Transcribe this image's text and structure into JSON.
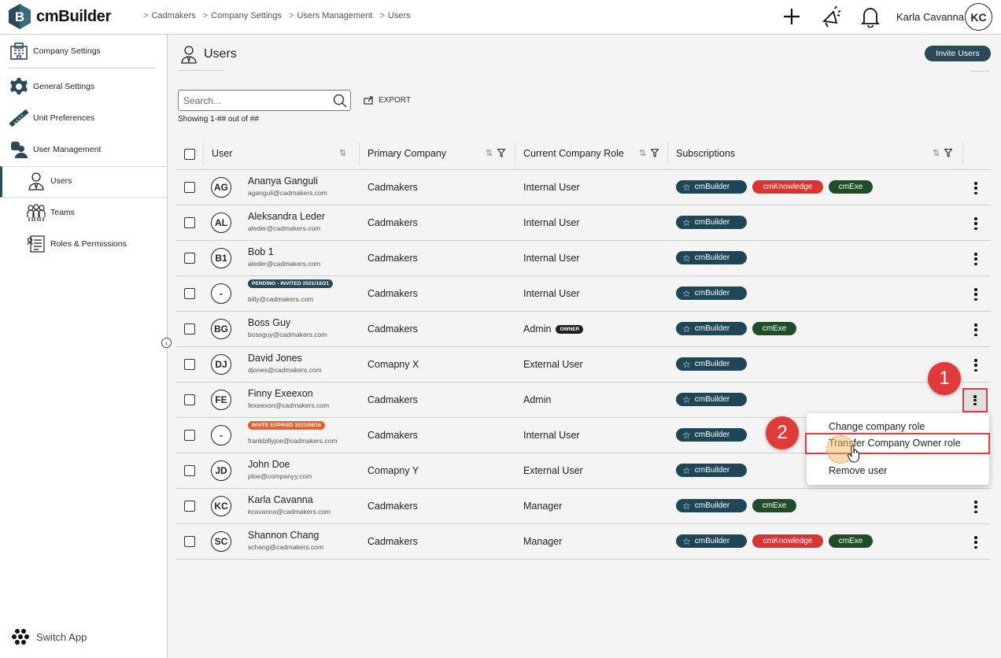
{
  "app": {
    "name": "cmBuilder"
  },
  "breadcrumb": [
    "Cadmakers",
    "Company Settings",
    "Users Management",
    "Users"
  ],
  "header": {
    "user_name": "Karla Cavanna",
    "user_initials": "KC"
  },
  "sidebar": {
    "items": [
      {
        "label": "Company Settings",
        "icon": "company-building-icon"
      },
      {
        "label": "General Settings",
        "icon": "gear-icon"
      },
      {
        "label": "Unit Preferences",
        "icon": "ruler-icon"
      },
      {
        "label": "User Management",
        "icon": "user-management-icon"
      },
      {
        "label": "Users",
        "icon": "user-icon"
      },
      {
        "label": "Teams",
        "icon": "teams-icon"
      },
      {
        "label": "Roles & Permissions",
        "icon": "roles-icon"
      }
    ],
    "switch_app": "Switch App"
  },
  "page": {
    "title": "Users",
    "invite_label": "Invite Users",
    "search_placeholder": "Search...",
    "export_label": "EXPORT",
    "showing": "Showing 1-## out of ##"
  },
  "table": {
    "columns": [
      "User",
      "Primary Company",
      "Current Company Role",
      "Subscriptions"
    ],
    "rows": [
      {
        "initials": "AG",
        "name": "Ananya Ganguli",
        "badge": "",
        "email": "aganguli@cadmakers.com",
        "company": "Cadmakers",
        "role": "Internal User",
        "role_badge": "",
        "subs": [
          "cmBuilder",
          "cmKnowledge",
          "cmExe"
        ]
      },
      {
        "initials": "AL",
        "name": "Aleksandra Leder",
        "badge": "",
        "email": "aleder@cadmakers.com",
        "company": "Cadmakers",
        "role": "Internal User",
        "role_badge": "",
        "subs": [
          "cmBuilder"
        ]
      },
      {
        "initials": "B1",
        "name": "Bob 1",
        "badge": "",
        "email": "aleder@cadmakers.com",
        "company": "Cadmakers",
        "role": "Internal User",
        "role_badge": "",
        "subs": [
          "cmBuilder"
        ]
      },
      {
        "initials": "-",
        "name": "",
        "badge": "PENDING - INVITED 2021/10/21",
        "badge_type": "pending",
        "email": "billy@cadmakers.com",
        "company": "Cadmakers",
        "role": "Internal User",
        "role_badge": "",
        "subs": [
          "cmBuilder"
        ]
      },
      {
        "initials": "BG",
        "name": "Boss Guy",
        "badge": "",
        "email": "bossguy@cadmakers.com",
        "company": "Cadmakers",
        "role": "Admin",
        "role_badge": "OWNER",
        "subs": [
          "cmBuilder",
          "cmExe"
        ]
      },
      {
        "initials": "DJ",
        "name": "David Jones",
        "badge": "",
        "email": "djones@cadmakers.com",
        "company": "Comapny X",
        "role": "External User",
        "role_badge": "",
        "subs": [
          "cmBuilder"
        ]
      },
      {
        "initials": "FE",
        "name": "Finny Exeexon",
        "badge": "",
        "email": "fexeexon@cadmakers.com",
        "company": "Cadmakers",
        "role": "Admin",
        "role_badge": "",
        "subs": [
          "cmBuilder"
        ]
      },
      {
        "initials": "-",
        "name": "",
        "badge": "INVITE EXPIRED 2021/09/16",
        "badge_type": "expired",
        "email": "frankbillyjoe@cadmakers.com",
        "company": "Cadmakers",
        "role": "Internal User",
        "role_badge": "",
        "subs": [
          "cmBuilder"
        ]
      },
      {
        "initials": "JD",
        "name": "John Doe",
        "badge": "",
        "email": "jdoe@companyy.com",
        "company": "Comapny Y",
        "role": "External User",
        "role_badge": "",
        "subs": [
          "cmBuilder"
        ]
      },
      {
        "initials": "KC",
        "name": "Karla Cavanna",
        "badge": "",
        "email": "kcavanna@cadmakers.com",
        "company": "Cadmakers",
        "role": "Manager",
        "role_badge": "",
        "subs": [
          "cmBuilder",
          "cmExe"
        ]
      },
      {
        "initials": "SC",
        "name": "Shannon Chang",
        "badge": "",
        "email": "schang@cadmakers.com",
        "company": "Cadmakers",
        "role": "Manager",
        "role_badge": "",
        "subs": [
          "cmBuilder",
          "cmKnowledge",
          "cmExe"
        ]
      }
    ]
  },
  "row_menu": {
    "items": [
      "Change company role",
      "Transfer Company Owner role",
      "Remove user"
    ]
  },
  "steps": [
    "1",
    "2"
  ],
  "colors": {
    "primary": "#2b4a57",
    "cmbuilder": "#1e4656",
    "cmknowledge": "#d93434",
    "cmexe": "#1f4d27",
    "highlight": "#d94040"
  }
}
